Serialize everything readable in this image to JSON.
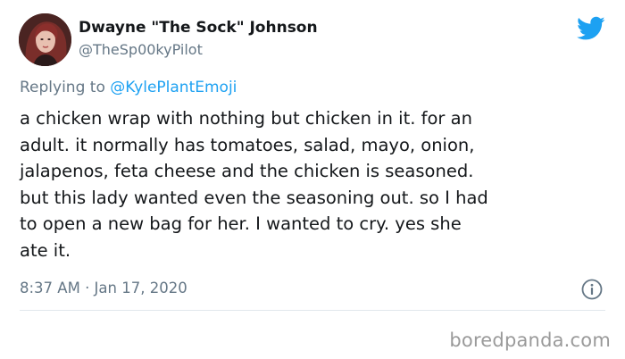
{
  "author": {
    "display_name": "Dwayne \"The Sock\" Johnson",
    "handle": "@TheSp00kyPilot",
    "avatar_icon": "user-avatar"
  },
  "platform": {
    "icon": "twitter-bird-icon",
    "color": "#1da1f2"
  },
  "reply": {
    "prefix": "Replying to ",
    "mention": "@KylePlantEmoji"
  },
  "tweet": {
    "text": "a chicken wrap with nothing but chicken in it. for an\nadult. it normally has tomatoes, salad, mayo, onion,\njalapenos, feta cheese and the chicken is seasoned.\nbut this lady wanted even the seasoning out. so I had\nto open a new bag for her. I wanted to cry. yes she\nate it.",
    "timestamp": "8:37 AM · Jan 17, 2020"
  },
  "watermark": "boredpanda.com",
  "colors": {
    "text": "#14171a",
    "secondary": "#657786",
    "link": "#1da1f2",
    "divider": "#e1e8ed"
  }
}
